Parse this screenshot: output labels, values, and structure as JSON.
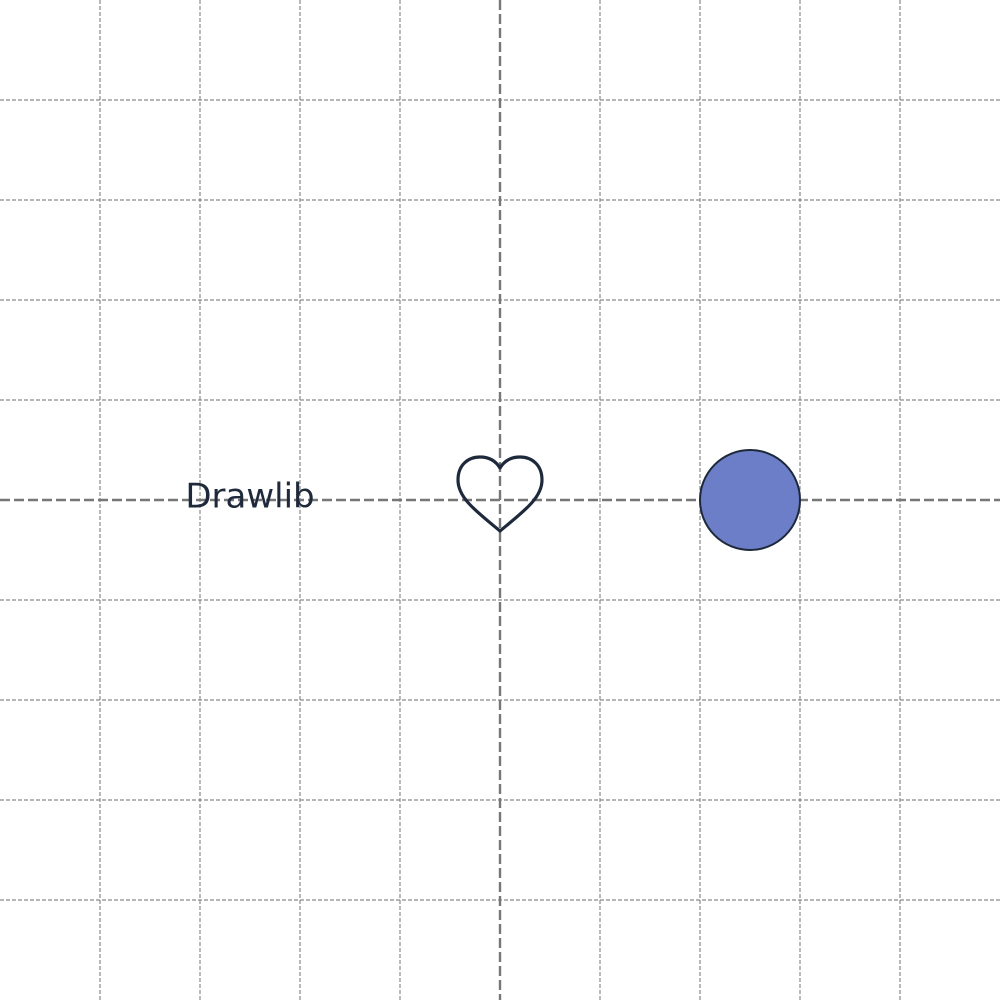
{
  "canvas": {
    "background_color": "#ffffff",
    "grid": true,
    "grid_color": "#8a8a8a",
    "axis_color": "#777777"
  },
  "text_label": {
    "text": "Drawlib",
    "color": "#1e293b"
  },
  "heart": {
    "icon": "heart-outline",
    "stroke_color": "#1e293b",
    "fill_color": "none"
  },
  "circle": {
    "fill_color": "#6d7ec8",
    "stroke_color": "#1e293b"
  }
}
